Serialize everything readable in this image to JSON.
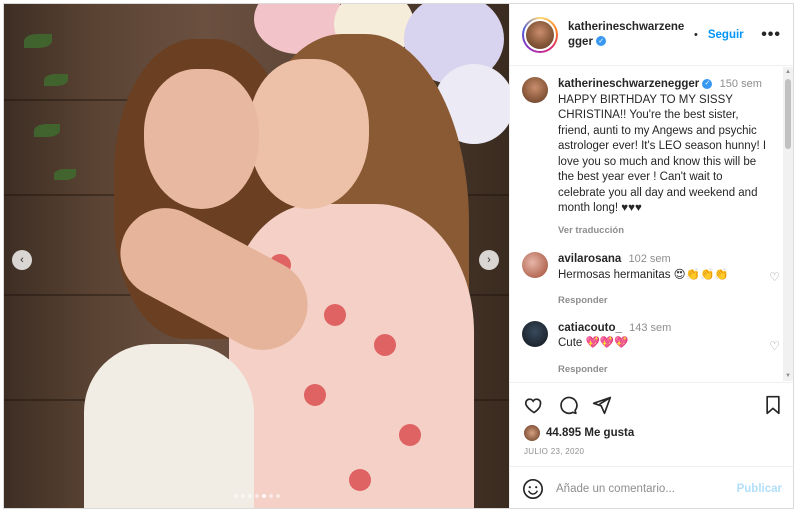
{
  "post": {
    "username": "katherineschwarzenegger",
    "follow_label": "Seguir",
    "more_glyph": "•••"
  },
  "carousel": {
    "prev_glyph": "‹",
    "next_glyph": "›",
    "slide_count": 7,
    "active_slide": 5
  },
  "caption": {
    "username": "katherineschwarzenegger",
    "time": "150 sem",
    "text": "HAPPY BIRTHDAY TO MY SISSY CHRISTINA!! You're the best sister, friend, aunti to my Angews and psychic astrologer ever! It's LEO season hunny! I love you so much and know this will be the best year ever ! Can't wait to celebrate you all day and weekend and month long! ♥♥♥",
    "translate_label": "Ver traducción"
  },
  "comments": [
    {
      "username": "avilarosana",
      "time": "102 sem",
      "text": "Hermosas hermanitas 😍👏👏👏",
      "reply_label": "Responder"
    },
    {
      "username": "catiacouto_",
      "time": "143 sem",
      "text": "Cute 💖💖💖",
      "reply_label": "Responder"
    }
  ],
  "stats": {
    "likes": "44.895 Me gusta",
    "date": "JULIO 23, 2020"
  },
  "add_comment": {
    "placeholder": "Añade un comentario...",
    "publish_label": "Publicar"
  },
  "colors": {
    "accent": "#0095f6",
    "publish_disabled": "#b2dffc",
    "muted": "#8e8e8e"
  }
}
